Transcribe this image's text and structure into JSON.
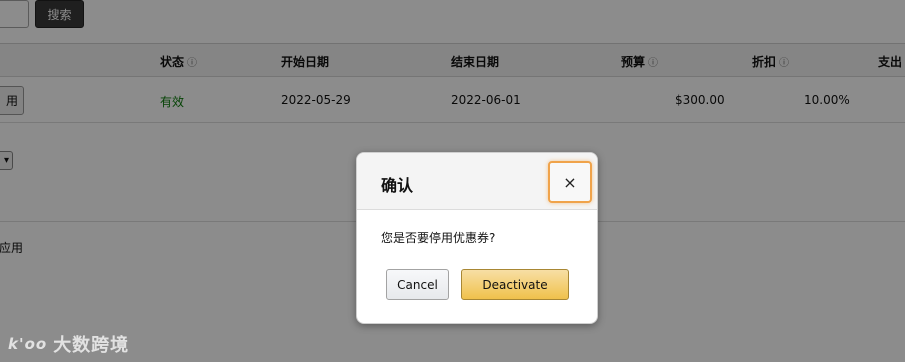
{
  "search": {
    "button_label": "搜索"
  },
  "table": {
    "columns": {
      "status": "状态",
      "start_date": "开始日期",
      "end_date": "结束日期",
      "budget": "预算",
      "discount": "折扣",
      "spend": "支出"
    },
    "info_glyph": "ⓘ",
    "row": {
      "action_label": "用",
      "status": "有效",
      "start_date": "2022-05-29",
      "end_date": "2022-06-01",
      "budget": "$300.00",
      "discount": "10.00%"
    }
  },
  "footer": {
    "select_glyph": "▾",
    "apply_text": "应用"
  },
  "watermark": {
    "logo": "k'oo",
    "text": "大数跨境"
  },
  "modal": {
    "title": "确认",
    "close_glyph": "×",
    "message": "您是否要停用优惠券?",
    "cancel_label": "Cancel",
    "deactivate_label": "Deactivate"
  },
  "colors": {
    "overlay": "#000000",
    "status_active": "#0a7a0a",
    "primary_button": "#f0c14b",
    "focus_ring": "#f0a34a"
  }
}
